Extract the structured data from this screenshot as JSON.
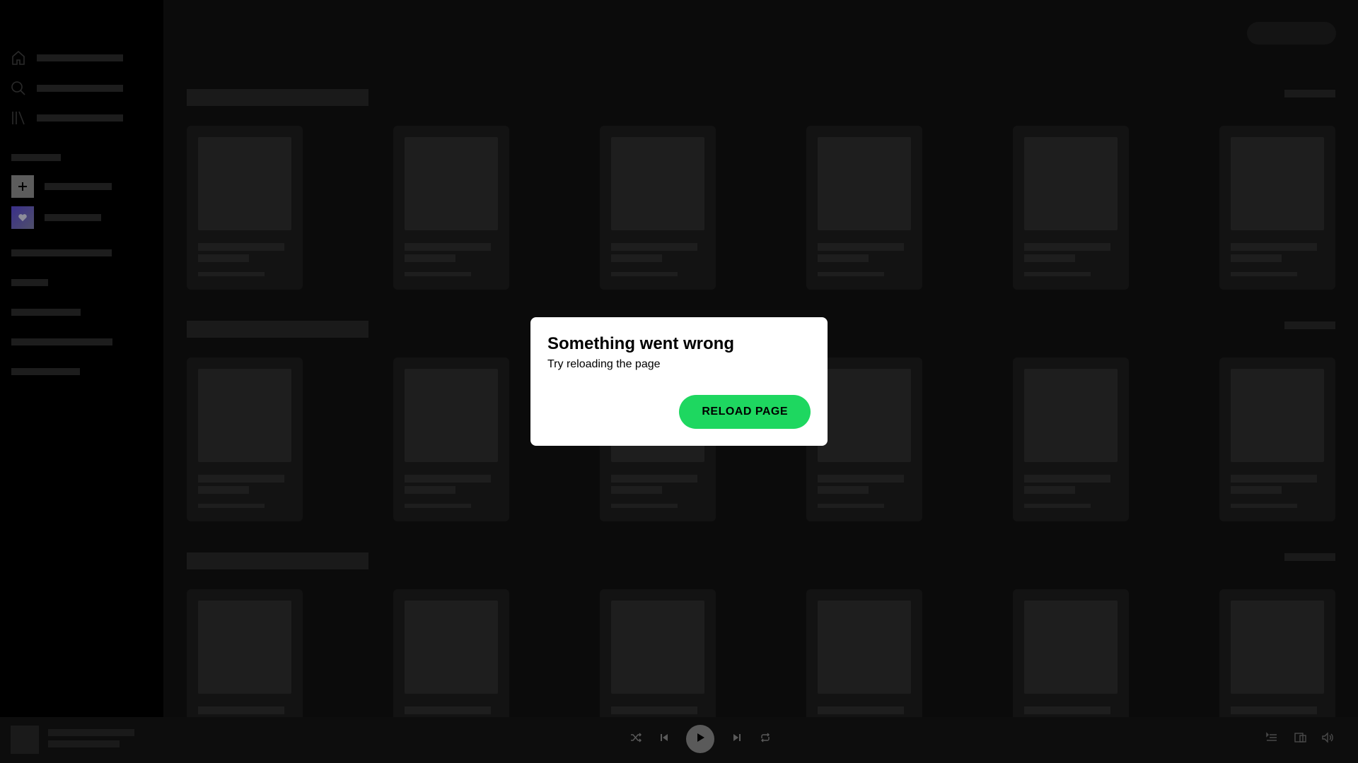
{
  "dialog": {
    "title": "Something went wrong",
    "message": "Try reloading the page",
    "button_label": "RELOAD PAGE"
  },
  "colors": {
    "accent": "#1ed760",
    "background": "#000000",
    "skeleton": "#1d1d1d"
  },
  "icons": {
    "nav": [
      "home-icon",
      "search-icon",
      "library-icon"
    ],
    "sidebar_actions": [
      "plus-icon",
      "heart-icon"
    ],
    "player": [
      "shuffle-icon",
      "previous-icon",
      "play-icon",
      "next-icon",
      "repeat-icon",
      "queue-icon",
      "devices-icon",
      "volume-icon"
    ]
  }
}
